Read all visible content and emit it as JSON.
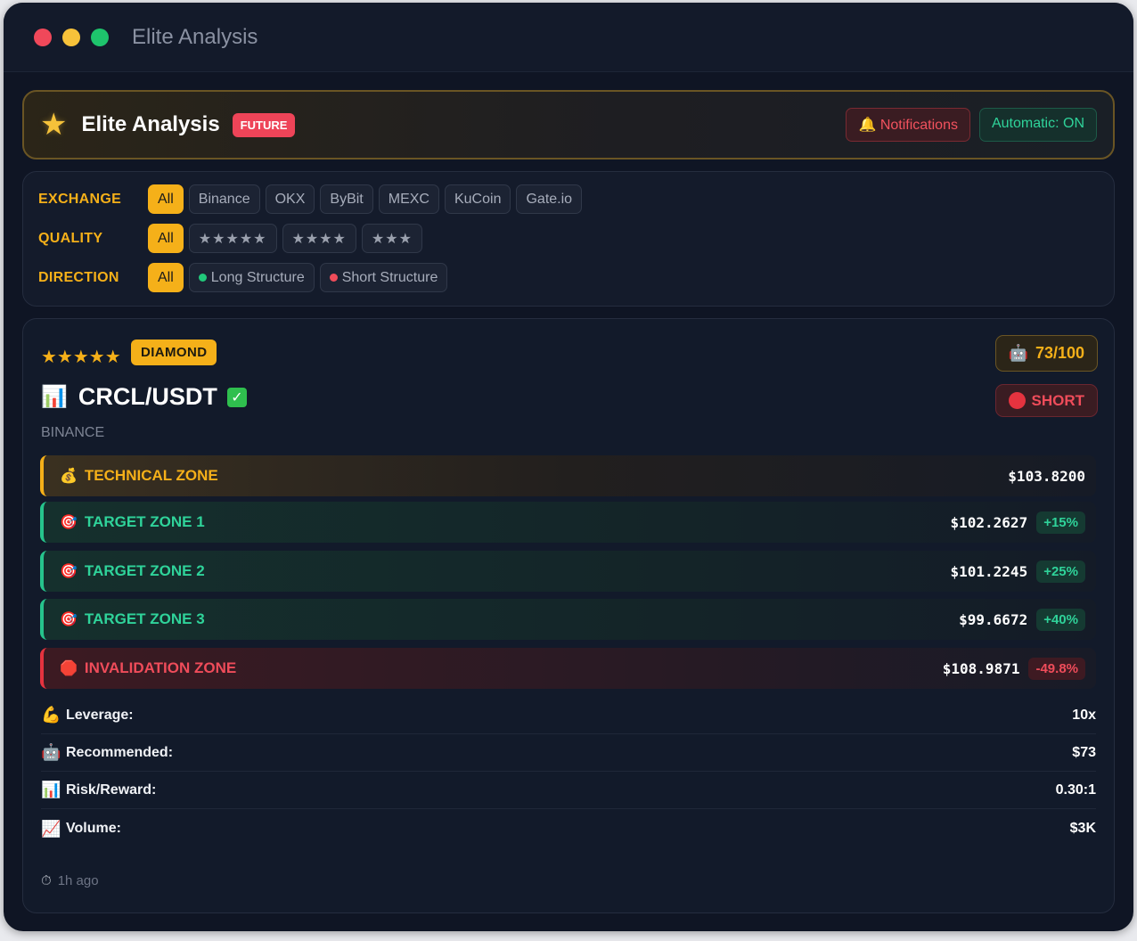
{
  "window": {
    "title": "Elite Analysis"
  },
  "header": {
    "title": "Elite Analysis",
    "badge": "FUTURE",
    "notifications_label": "🔔 Notifications",
    "automatic_label": "Automatic: ON"
  },
  "filters": {
    "exchange": {
      "label": "EXCHANGE",
      "options": [
        "All",
        "Binance",
        "OKX",
        "ByBit",
        "MEXC",
        "KuCoin",
        "Gate.io"
      ],
      "selected": "All"
    },
    "quality": {
      "label": "QUALITY",
      "options": [
        "All",
        "★★★★★",
        "★★★★",
        "★★★"
      ],
      "selected": "All"
    },
    "direction": {
      "label": "DIRECTION",
      "options": [
        "All",
        "Long Structure",
        "Short Structure"
      ],
      "selected": "All"
    }
  },
  "signal": {
    "stars": "★★★★★",
    "tier": "DIAMOND",
    "score": "73/100",
    "pair": "CRCL/USDT",
    "direction": "SHORT",
    "exchange": "BINANCE",
    "zones": [
      {
        "label": "TECHNICAL ZONE",
        "price": "$103.8200",
        "pct": ""
      },
      {
        "label": "TARGET ZONE 1",
        "price": "$102.2627",
        "pct": "+15%"
      },
      {
        "label": "TARGET ZONE 2",
        "price": "$101.2245",
        "pct": "+25%"
      },
      {
        "label": "TARGET ZONE 3",
        "price": "$99.6672",
        "pct": "+40%"
      },
      {
        "label": "INVALIDATION ZONE",
        "price": "$108.9871",
        "pct": "-49.8%"
      }
    ],
    "stats": [
      {
        "label": "Leverage:",
        "value": "10x"
      },
      {
        "label": "Recommended:",
        "value": "$73"
      },
      {
        "label": "Risk/Reward:",
        "value": "0.30:1"
      },
      {
        "label": "Volume:",
        "value": "$3K"
      }
    ],
    "time_ago": "1h ago"
  },
  "colors": {
    "accent_gold": "#f5b019",
    "long_green": "#2fd39a",
    "short_red": "#ef4c5a",
    "background": "#0f1524"
  },
  "icons": {
    "star": "star-icon",
    "bell": "bell-icon",
    "bar_chart": "bar-chart-icon",
    "check": "check-icon",
    "robot": "robot-icon",
    "money_bag": "money-bag-icon",
    "target": "target-icon",
    "stop": "stop-icon",
    "flexed_arm": "flexed-arm-icon",
    "trend_up": "chart-increasing-icon",
    "stopwatch": "stopwatch-icon"
  }
}
